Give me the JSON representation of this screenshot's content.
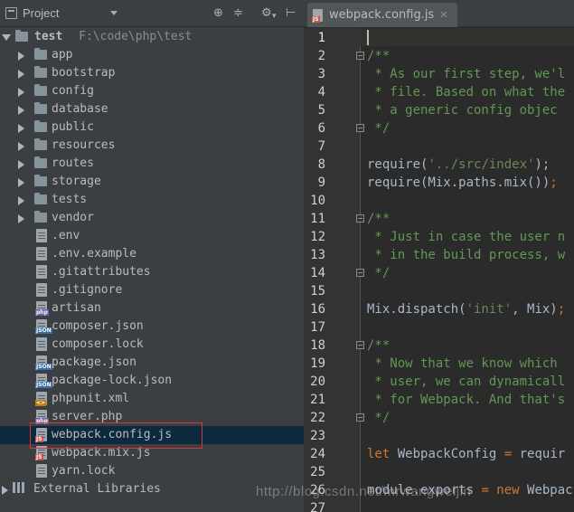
{
  "project_panel": {
    "title": "Project",
    "root_name": "test",
    "root_path": "F:\\code\\php\\test",
    "folders": [
      "app",
      "bootstrap",
      "config",
      "database",
      "public",
      "resources",
      "routes",
      "storage",
      "tests",
      "vendor"
    ],
    "files": [
      {
        "name": ".env",
        "badge": ""
      },
      {
        "name": ".env.example",
        "badge": ""
      },
      {
        "name": ".gitattributes",
        "badge": ""
      },
      {
        "name": ".gitignore",
        "badge": ""
      },
      {
        "name": "artisan",
        "badge": "php"
      },
      {
        "name": "composer.json",
        "badge": "JSON"
      },
      {
        "name": "composer.lock",
        "badge": ""
      },
      {
        "name": "package.json",
        "badge": "JSON"
      },
      {
        "name": "package-lock.json",
        "badge": "JSON"
      },
      {
        "name": "phpunit.xml",
        "badge": "<>"
      },
      {
        "name": "server.php",
        "badge": "php"
      },
      {
        "name": "webpack.config.js",
        "badge": "JS"
      },
      {
        "name": "webpack.mix.js",
        "badge": "JS"
      },
      {
        "name": "yarn.lock",
        "badge": ""
      }
    ],
    "external_libraries": "External Libraries",
    "selected_file": "webpack.config.js"
  },
  "editor": {
    "tab_label": "webpack.config.js",
    "line_numbers": [
      "1",
      "2",
      "3",
      "4",
      "5",
      "6",
      "7",
      "8",
      "9",
      "10",
      "11",
      "12",
      "13",
      "14",
      "15",
      "16",
      "17",
      "18",
      "19",
      "20",
      "21",
      "22",
      "23",
      "24",
      "25",
      "26",
      "27"
    ],
    "lines": {
      "l2": "/**",
      "l3": " * As our first step, we'l",
      "l4": " * file. Based on what the",
      "l5": " * a generic config objec",
      "l6": " */",
      "l8_fn": "require(",
      "l8_str": "'../src/index'",
      "l8_end": ");",
      "l9_a": "require(Mix.paths.mix())",
      "l9_end": ";",
      "l11": "/**",
      "l12": " * Just in case the user n",
      "l13": " * in the build process, w",
      "l14": " */",
      "l16_a": "Mix.dispatch(",
      "l16_str": "'init'",
      "l16_b": ", Mix)",
      "l16_end": ";",
      "l18": "/**",
      "l19": " * Now that we know which",
      "l20": " * user, we can dynamicall",
      "l21": " * for Webpack. And that's",
      "l22": " */",
      "l24_kw": "let",
      "l24_a": " WebpackConfig ",
      "l24_eq": "=",
      "l24_b": " requir",
      "l26_a": "module.exports ",
      "l26_eq": "=",
      "l26_kw": " new",
      "l26_b": " Webpac"
    }
  },
  "watermark": "http://blog.csdn.net/mrwangweijin",
  "colors": {
    "panel_bg": "#3c3f41",
    "editor_bg": "#2b2b2b",
    "comment": "#629755",
    "string": "#6a8759",
    "keyword": "#cc7832",
    "highlight_border": "#d43a3a",
    "selection": "#0d293e"
  }
}
